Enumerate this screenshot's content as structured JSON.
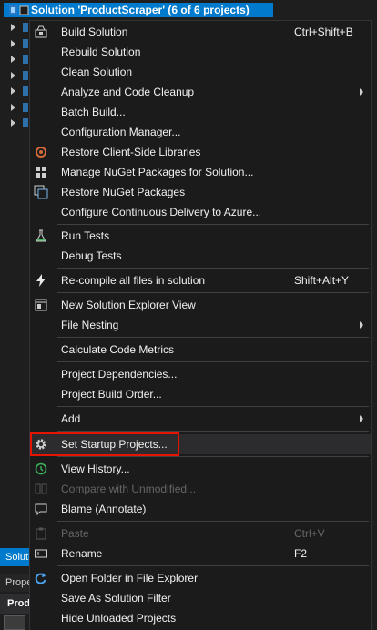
{
  "solution_explorer": {
    "title": "Solution 'ProductScraper' (6 of 6 projects)",
    "bottom_tab": "Solution Explorer",
    "properties_tab": "Properties",
    "properties_header": "ProductScraper"
  },
  "menu": {
    "build_solution": {
      "label": "Build Solution",
      "shortcut": "Ctrl+Shift+B"
    },
    "rebuild_solution": {
      "label": "Rebuild Solution"
    },
    "clean_solution": {
      "label": "Clean Solution"
    },
    "analyze": {
      "label": "Analyze and Code Cleanup"
    },
    "batch_build": {
      "label": "Batch Build..."
    },
    "config_manager": {
      "label": "Configuration Manager..."
    },
    "restore_client": {
      "label": "Restore Client-Side Libraries"
    },
    "manage_nuget": {
      "label": "Manage NuGet Packages for Solution..."
    },
    "restore_nuget": {
      "label": "Restore NuGet Packages"
    },
    "configure_cd": {
      "label": "Configure Continuous Delivery to Azure..."
    },
    "run_tests": {
      "label": "Run Tests"
    },
    "debug_tests": {
      "label": "Debug Tests"
    },
    "recompile": {
      "label": "Re-compile all files in solution",
      "shortcut": "Shift+Alt+Y"
    },
    "new_se_view": {
      "label": "New Solution Explorer View"
    },
    "file_nesting": {
      "label": "File Nesting"
    },
    "code_metrics": {
      "label": "Calculate Code Metrics"
    },
    "project_deps": {
      "label": "Project Dependencies..."
    },
    "build_order": {
      "label": "Project Build Order..."
    },
    "add": {
      "label": "Add"
    },
    "set_startup": {
      "label": "Set Startup Projects..."
    },
    "view_history": {
      "label": "View History..."
    },
    "compare": {
      "label": "Compare with Unmodified..."
    },
    "blame": {
      "label": "Blame (Annotate)"
    },
    "paste": {
      "label": "Paste",
      "shortcut": "Ctrl+V"
    },
    "rename": {
      "label": "Rename",
      "shortcut": "F2"
    },
    "open_folder": {
      "label": "Open Folder in File Explorer"
    },
    "save_filter": {
      "label": "Save As Solution Filter"
    },
    "hide_unloaded": {
      "label": "Hide Unloaded Projects"
    }
  },
  "colors": {
    "accent": "#007acc",
    "highlight_border": "#e51400",
    "menu_bg": "#1b1b1c",
    "disabled_text": "#656565"
  }
}
